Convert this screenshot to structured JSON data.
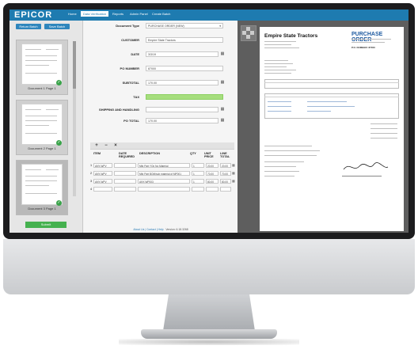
{
  "app": {
    "logo": "EPICOR",
    "nav": [
      "Home",
      "Data Verification",
      "Reports",
      "Admin Panel",
      "Create Batch"
    ],
    "active_nav_index": 1
  },
  "sidebar": {
    "buttons": [
      "Return Batch",
      "Save Batch"
    ],
    "thumbnails": [
      {
        "caption": "Document 1 Page 1"
      },
      {
        "caption": "Document 2 Page 1"
      },
      {
        "caption": "Document 3 Page 1"
      }
    ],
    "submit_label": "Submit"
  },
  "form": {
    "document_type_label": "Document Type",
    "document_type_value": "PURCHASE ORDER (NEW)",
    "fields": [
      {
        "label": "CUSTOMER",
        "value": "Empire State Tractors",
        "has_calendar": false,
        "highlight": false
      },
      {
        "label": "DATE",
        "value": "3/3/19",
        "has_calendar": true,
        "highlight": false
      },
      {
        "label": "PO NUMBER",
        "value": "87000",
        "has_calendar": false,
        "highlight": false
      },
      {
        "label": "SUBTOTAL",
        "value": "170.00",
        "has_calendar": true,
        "highlight": false
      },
      {
        "label": "TAX",
        "value": "",
        "has_calendar": false,
        "highlight": true
      },
      {
        "label": "SHIPPING AND HANDLING",
        "value": "",
        "has_calendar": true,
        "highlight": false
      },
      {
        "label": "PO TOTAL",
        "value": "170.00",
        "has_calendar": true,
        "highlight": false
      }
    ]
  },
  "line_items": {
    "toolbar": [
      "+",
      "−",
      "×"
    ],
    "headers": [
      "ITEM",
      "DATE REQUIRED",
      "DESCRIPTION",
      "QTY",
      "UNIT PRICE",
      "LINE TOTAL"
    ],
    "rows": [
      {
        "num": "1",
        "item": "ANY-WPV",
        "date": "",
        "desc": "Mfg Part YOp No Material",
        "qty": "1",
        "unit": "20.00",
        "total": "20.00"
      },
      {
        "num": "2",
        "item": "ANY-WPV",
        "date": "",
        "desc": "Mfg Part BOM/sub material of MP001",
        "qty": "1",
        "unit": "70.00",
        "total": "70.00"
      },
      {
        "num": "3",
        "item": "ANY-WPV",
        "date": "",
        "desc": "ANY-WP003",
        "qty": "1",
        "unit": "80.00",
        "total": "80.00"
      },
      {
        "num": "4",
        "item": "",
        "date": "",
        "desc": "",
        "qty": "",
        "unit": "",
        "total": ""
      }
    ]
  },
  "document": {
    "company": "Empire State Tractors",
    "title": "PURCHASE ORDER",
    "po_label": "P.O. NUMBER: 87000"
  },
  "footer": {
    "links": "About Us | Contact | Help",
    "version": "Version: 6.18.3268"
  },
  "colors": {
    "topbar": "#1e7bb0",
    "accent": "#2f86bd",
    "submit": "#45b14f",
    "tax_highlight": "#a6de7e",
    "check": "#3aa34a"
  }
}
